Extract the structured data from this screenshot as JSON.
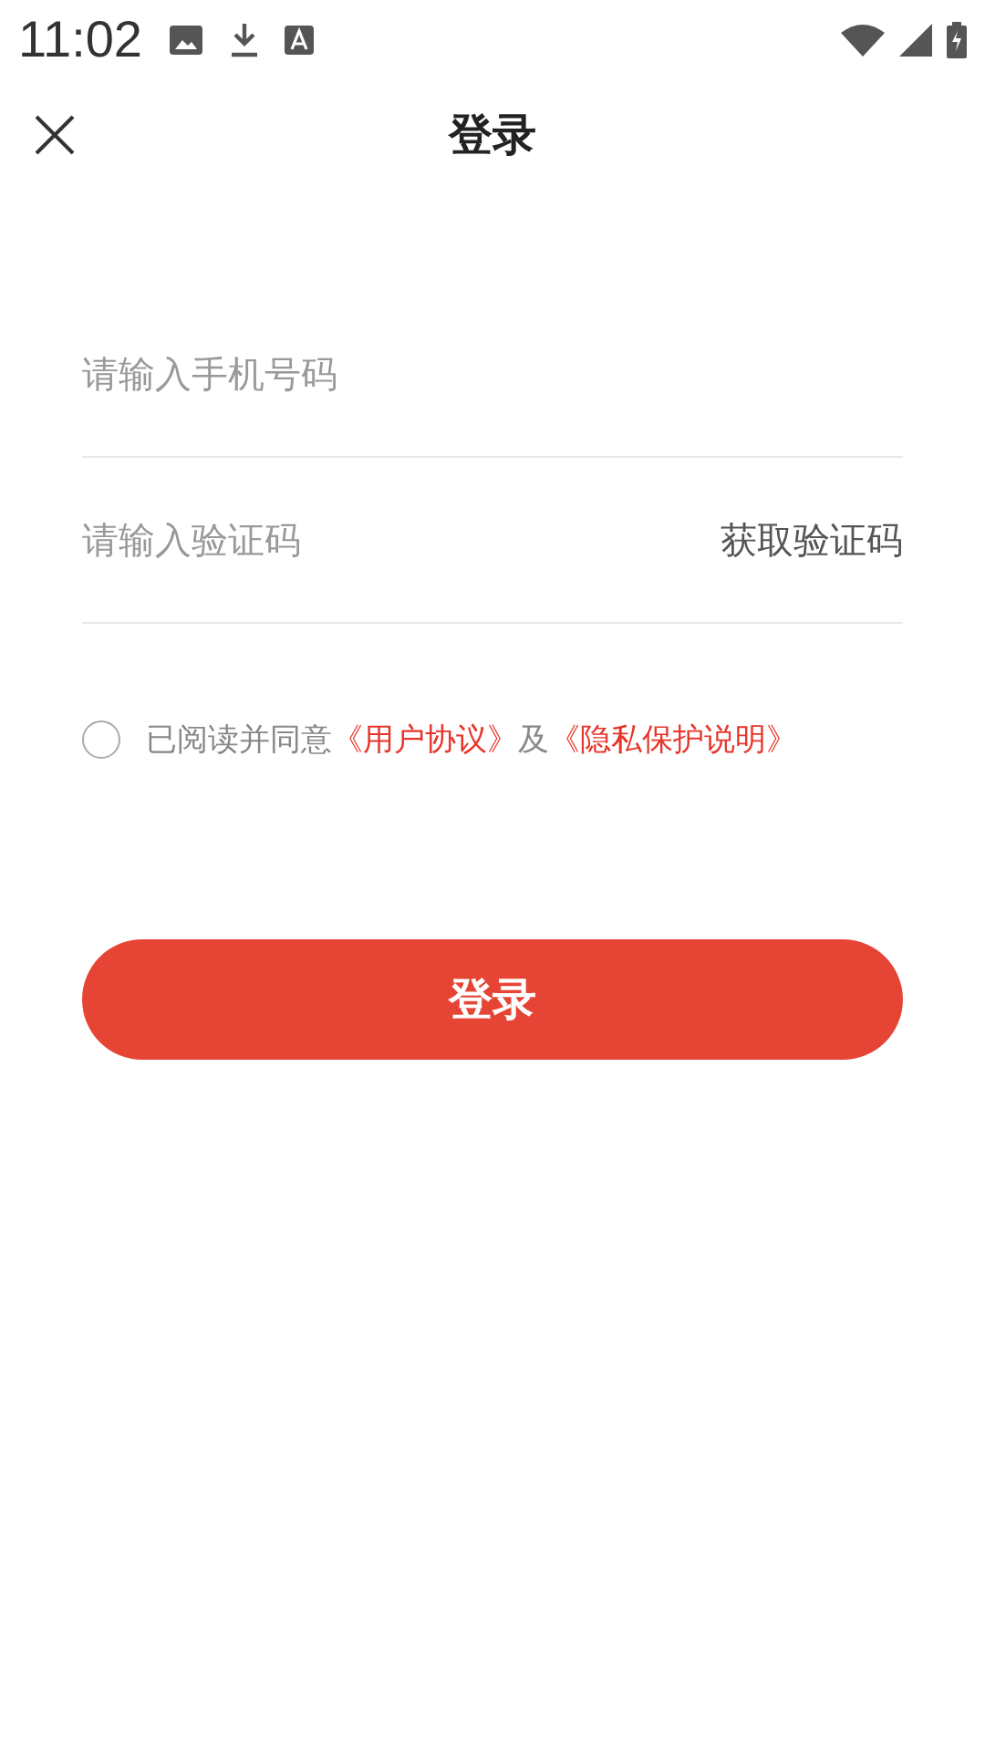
{
  "status_bar": {
    "time": "11:02"
  },
  "header": {
    "title": "登录"
  },
  "phone_field": {
    "placeholder": "请输入手机号码"
  },
  "code_field": {
    "placeholder": "请输入验证码",
    "action": "获取验证码"
  },
  "agreement": {
    "checked": false,
    "parts": [
      {
        "kind": "text",
        "text": "已阅读并同意"
      },
      {
        "kind": "link",
        "text": "《用户协议》"
      },
      {
        "kind": "text",
        "text": "及"
      },
      {
        "kind": "link",
        "text": "《隐私保护说明》"
      }
    ]
  },
  "submit": {
    "label": "登录"
  }
}
